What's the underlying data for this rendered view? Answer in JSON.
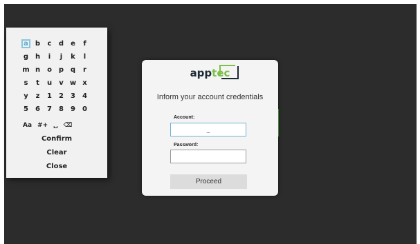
{
  "keyboard": {
    "letter_rows": [
      [
        "a",
        "b",
        "c",
        "d",
        "e",
        "f"
      ],
      [
        "g",
        "h",
        "i",
        "j",
        "k",
        "l"
      ],
      [
        "m",
        "n",
        "o",
        "p",
        "q",
        "r"
      ],
      [
        "s",
        "t",
        "u",
        "v",
        "w",
        "x"
      ],
      [
        "y",
        "z",
        "1",
        "2",
        "3",
        "4"
      ],
      [
        "5",
        "6",
        "7",
        "8",
        "9",
        "0"
      ]
    ],
    "selected_key": "a",
    "case_toggle_label": "Aa",
    "symbols_label": "#+",
    "space_label": "␣",
    "backspace_label": "⌫",
    "confirm_label": "Confirm",
    "clear_label": "Clear",
    "close_label": "Close"
  },
  "login": {
    "logo_text_a": "app",
    "logo_text_b": "tec",
    "headline": "Inform your account credentials",
    "account_label": "Account:",
    "account_value": "_",
    "password_label": "Password:",
    "password_value": "",
    "proceed_label": "Proceed"
  },
  "colors": {
    "background": "#2c2c2c",
    "accent_green": "#7cc04a",
    "focus_blue": "#6fb2d2"
  }
}
